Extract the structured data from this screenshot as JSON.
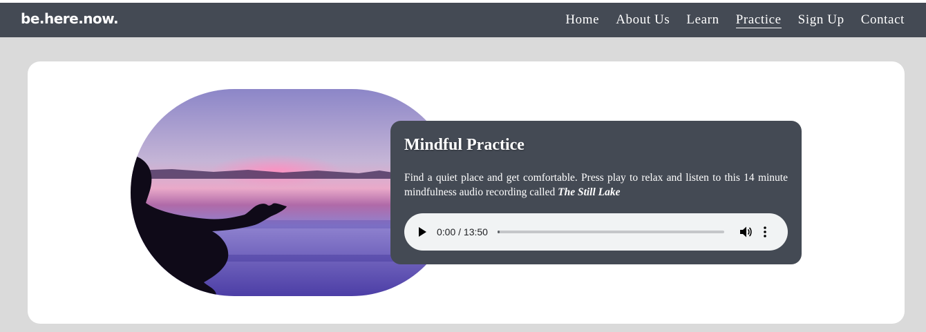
{
  "brand": {
    "logo": "be.here.now."
  },
  "nav": {
    "items": [
      "Home",
      "About Us",
      "Learn",
      "Practice",
      "Sign Up",
      "Contact"
    ],
    "active": "Practice"
  },
  "practice": {
    "title": "Mindful Practice",
    "description": "Find a quiet place and get comfortable. Press play to relax and listen to this 14 minute mindfulness audio recording called",
    "recording_title": "The Still Lake"
  },
  "audio": {
    "time_display": "0:00 / 13:50",
    "progress_fraction": 0,
    "icons": {
      "play": "play-icon",
      "volume": "volume-icon",
      "more": "more-options-icon"
    }
  },
  "colors": {
    "navbar": "#444a54",
    "page_bg": "#dadada",
    "card_bg": "#ffffff",
    "panel_bg": "#444a54",
    "player_bg": "#f1f3f4"
  }
}
